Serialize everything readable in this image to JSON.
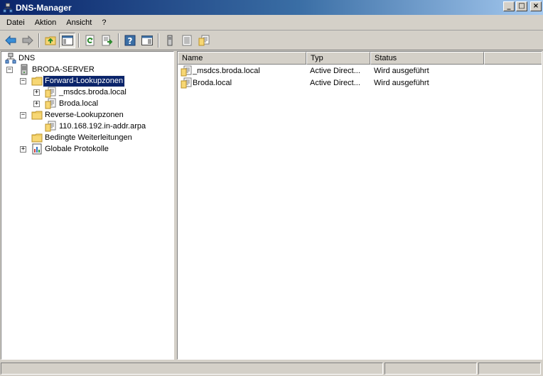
{
  "window": {
    "title": "DNS-Manager",
    "buttons": {
      "minimize": "_",
      "maximize": "□",
      "close": "×"
    }
  },
  "menu": [
    "Datei",
    "Aktion",
    "Ansicht",
    "?"
  ],
  "toolbar": {
    "icons": [
      "back-arrow-icon",
      "forward-arrow-icon",
      "up-folder-icon",
      "show-hide-tree-icon",
      "refresh-icon",
      "export-list-icon",
      "help-icon",
      "properties-pane-icon",
      "server-icon",
      "list-icon",
      "zone-file-icon"
    ]
  },
  "tree": {
    "root": {
      "label": "DNS"
    },
    "server": {
      "label": "BRODA-SERVER",
      "expander": "−"
    },
    "forward": {
      "label": "Forward-Lookupzonen",
      "expander": "−",
      "selected": true
    },
    "forward_children": [
      {
        "label": "_msdcs.broda.local",
        "expander": "+"
      },
      {
        "label": "Broda.local",
        "expander": "+"
      }
    ],
    "reverse": {
      "label": "Reverse-Lookupzonen",
      "expander": "−"
    },
    "reverse_children": [
      {
        "label": "110.168.192.in-addr.arpa"
      }
    ],
    "conditional": {
      "label": "Bedingte Weiterleitungen"
    },
    "global_logs": {
      "label": "Globale Protokolle",
      "expander": "+"
    }
  },
  "list": {
    "columns": [
      "Name",
      "Typ",
      "Status"
    ],
    "rows": [
      {
        "name": "_msdcs.broda.local",
        "type": "Active Direct...",
        "status": "Wird ausgeführt"
      },
      {
        "name": "Broda.local",
        "type": "Active Direct...",
        "status": "Wird ausgeführt"
      }
    ]
  },
  "statusbar": [
    "",
    "",
    ""
  ],
  "colors": {
    "title_start": "#0a246a",
    "title_end": "#a6caf0",
    "selection": "#0a246a",
    "chrome": "#d4d0c8"
  }
}
